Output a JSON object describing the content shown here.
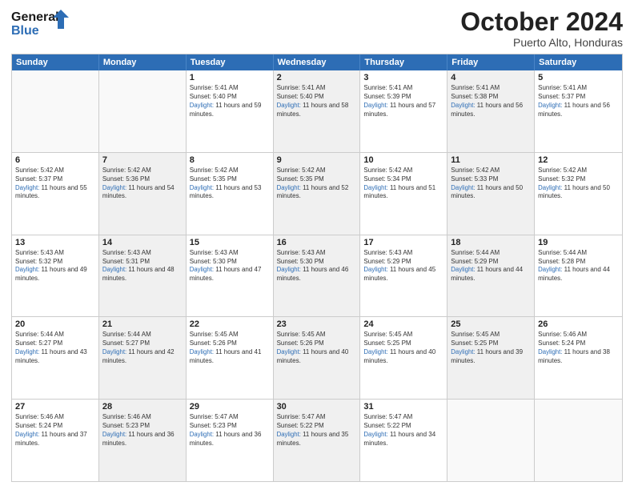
{
  "header": {
    "logo_line1": "General",
    "logo_line2": "Blue",
    "month": "October 2024",
    "location": "Puerto Alto, Honduras"
  },
  "weekdays": [
    "Sunday",
    "Monday",
    "Tuesday",
    "Wednesday",
    "Thursday",
    "Friday",
    "Saturday"
  ],
  "weeks": [
    [
      {
        "day": "",
        "sunrise": "",
        "sunset": "",
        "daylight": "",
        "shaded": false,
        "empty": true
      },
      {
        "day": "",
        "sunrise": "",
        "sunset": "",
        "daylight": "",
        "shaded": true,
        "empty": true
      },
      {
        "day": "1",
        "sunrise": "Sunrise: 5:41 AM",
        "sunset": "Sunset: 5:40 PM",
        "daylight": "Daylight: 11 hours and 59 minutes.",
        "shaded": false
      },
      {
        "day": "2",
        "sunrise": "Sunrise: 5:41 AM",
        "sunset": "Sunset: 5:40 PM",
        "daylight": "Daylight: 11 hours and 58 minutes.",
        "shaded": true
      },
      {
        "day": "3",
        "sunrise": "Sunrise: 5:41 AM",
        "sunset": "Sunset: 5:39 PM",
        "daylight": "Daylight: 11 hours and 57 minutes.",
        "shaded": false
      },
      {
        "day": "4",
        "sunrise": "Sunrise: 5:41 AM",
        "sunset": "Sunset: 5:38 PM",
        "daylight": "Daylight: 11 hours and 56 minutes.",
        "shaded": true
      },
      {
        "day": "5",
        "sunrise": "Sunrise: 5:41 AM",
        "sunset": "Sunset: 5:37 PM",
        "daylight": "Daylight: 11 hours and 56 minutes.",
        "shaded": false
      }
    ],
    [
      {
        "day": "6",
        "sunrise": "Sunrise: 5:42 AM",
        "sunset": "Sunset: 5:37 PM",
        "daylight": "Daylight: 11 hours and 55 minutes.",
        "shaded": false
      },
      {
        "day": "7",
        "sunrise": "Sunrise: 5:42 AM",
        "sunset": "Sunset: 5:36 PM",
        "daylight": "Daylight: 11 hours and 54 minutes.",
        "shaded": true
      },
      {
        "day": "8",
        "sunrise": "Sunrise: 5:42 AM",
        "sunset": "Sunset: 5:35 PM",
        "daylight": "Daylight: 11 hours and 53 minutes.",
        "shaded": false
      },
      {
        "day": "9",
        "sunrise": "Sunrise: 5:42 AM",
        "sunset": "Sunset: 5:35 PM",
        "daylight": "Daylight: 11 hours and 52 minutes.",
        "shaded": true
      },
      {
        "day": "10",
        "sunrise": "Sunrise: 5:42 AM",
        "sunset": "Sunset: 5:34 PM",
        "daylight": "Daylight: 11 hours and 51 minutes.",
        "shaded": false
      },
      {
        "day": "11",
        "sunrise": "Sunrise: 5:42 AM",
        "sunset": "Sunset: 5:33 PM",
        "daylight": "Daylight: 11 hours and 50 minutes.",
        "shaded": true
      },
      {
        "day": "12",
        "sunrise": "Sunrise: 5:42 AM",
        "sunset": "Sunset: 5:32 PM",
        "daylight": "Daylight: 11 hours and 50 minutes.",
        "shaded": false
      }
    ],
    [
      {
        "day": "13",
        "sunrise": "Sunrise: 5:43 AM",
        "sunset": "Sunset: 5:32 PM",
        "daylight": "Daylight: 11 hours and 49 minutes.",
        "shaded": false
      },
      {
        "day": "14",
        "sunrise": "Sunrise: 5:43 AM",
        "sunset": "Sunset: 5:31 PM",
        "daylight": "Daylight: 11 hours and 48 minutes.",
        "shaded": true
      },
      {
        "day": "15",
        "sunrise": "Sunrise: 5:43 AM",
        "sunset": "Sunset: 5:30 PM",
        "daylight": "Daylight: 11 hours and 47 minutes.",
        "shaded": false
      },
      {
        "day": "16",
        "sunrise": "Sunrise: 5:43 AM",
        "sunset": "Sunset: 5:30 PM",
        "daylight": "Daylight: 11 hours and 46 minutes.",
        "shaded": true
      },
      {
        "day": "17",
        "sunrise": "Sunrise: 5:43 AM",
        "sunset": "Sunset: 5:29 PM",
        "daylight": "Daylight: 11 hours and 45 minutes.",
        "shaded": false
      },
      {
        "day": "18",
        "sunrise": "Sunrise: 5:44 AM",
        "sunset": "Sunset: 5:29 PM",
        "daylight": "Daylight: 11 hours and 44 minutes.",
        "shaded": true
      },
      {
        "day": "19",
        "sunrise": "Sunrise: 5:44 AM",
        "sunset": "Sunset: 5:28 PM",
        "daylight": "Daylight: 11 hours and 44 minutes.",
        "shaded": false
      }
    ],
    [
      {
        "day": "20",
        "sunrise": "Sunrise: 5:44 AM",
        "sunset": "Sunset: 5:27 PM",
        "daylight": "Daylight: 11 hours and 43 minutes.",
        "shaded": false
      },
      {
        "day": "21",
        "sunrise": "Sunrise: 5:44 AM",
        "sunset": "Sunset: 5:27 PM",
        "daylight": "Daylight: 11 hours and 42 minutes.",
        "shaded": true
      },
      {
        "day": "22",
        "sunrise": "Sunrise: 5:45 AM",
        "sunset": "Sunset: 5:26 PM",
        "daylight": "Daylight: 11 hours and 41 minutes.",
        "shaded": false
      },
      {
        "day": "23",
        "sunrise": "Sunrise: 5:45 AM",
        "sunset": "Sunset: 5:26 PM",
        "daylight": "Daylight: 11 hours and 40 minutes.",
        "shaded": true
      },
      {
        "day": "24",
        "sunrise": "Sunrise: 5:45 AM",
        "sunset": "Sunset: 5:25 PM",
        "daylight": "Daylight: 11 hours and 40 minutes.",
        "shaded": false
      },
      {
        "day": "25",
        "sunrise": "Sunrise: 5:45 AM",
        "sunset": "Sunset: 5:25 PM",
        "daylight": "Daylight: 11 hours and 39 minutes.",
        "shaded": true
      },
      {
        "day": "26",
        "sunrise": "Sunrise: 5:46 AM",
        "sunset": "Sunset: 5:24 PM",
        "daylight": "Daylight: 11 hours and 38 minutes.",
        "shaded": false
      }
    ],
    [
      {
        "day": "27",
        "sunrise": "Sunrise: 5:46 AM",
        "sunset": "Sunset: 5:24 PM",
        "daylight": "Daylight: 11 hours and 37 minutes.",
        "shaded": false
      },
      {
        "day": "28",
        "sunrise": "Sunrise: 5:46 AM",
        "sunset": "Sunset: 5:23 PM",
        "daylight": "Daylight: 11 hours and 36 minutes.",
        "shaded": true
      },
      {
        "day": "29",
        "sunrise": "Sunrise: 5:47 AM",
        "sunset": "Sunset: 5:23 PM",
        "daylight": "Daylight: 11 hours and 36 minutes.",
        "shaded": false
      },
      {
        "day": "30",
        "sunrise": "Sunrise: 5:47 AM",
        "sunset": "Sunset: 5:22 PM",
        "daylight": "Daylight: 11 hours and 35 minutes.",
        "shaded": true
      },
      {
        "day": "31",
        "sunrise": "Sunrise: 5:47 AM",
        "sunset": "Sunset: 5:22 PM",
        "daylight": "Daylight: 11 hours and 34 minutes.",
        "shaded": false
      },
      {
        "day": "",
        "sunrise": "",
        "sunset": "",
        "daylight": "",
        "shaded": true,
        "empty": true
      },
      {
        "day": "",
        "sunrise": "",
        "sunset": "",
        "daylight": "",
        "shaded": false,
        "empty": true
      }
    ]
  ]
}
